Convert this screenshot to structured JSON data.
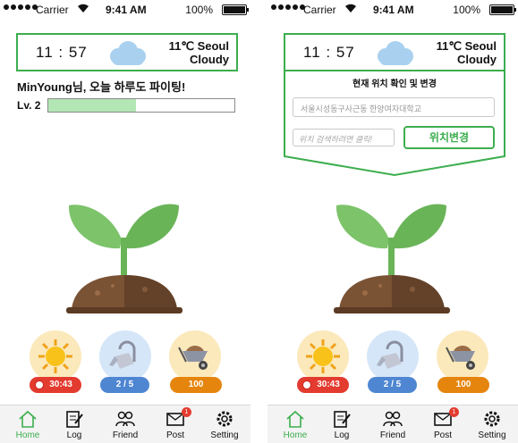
{
  "status": {
    "carrier": "Carrier",
    "time": "9:41 AM",
    "battery": "100%"
  },
  "weather": {
    "clock": "11 : 57",
    "temp_city": "11℃ Seoul",
    "condition": "Cloudy",
    "icon": "cloud-icon"
  },
  "greeting": "MinYoung님, 오늘 하루도 파이팅!",
  "level": {
    "label": "Lv. 2",
    "progress": 0.47
  },
  "actions": [
    {
      "name": "sun",
      "icon": "sun-icon",
      "label": "30:43"
    },
    {
      "name": "water",
      "icon": "watering-can-icon",
      "label": "2 / 5"
    },
    {
      "name": "fertilizer",
      "icon": "wheelbarrow-icon",
      "label": "100"
    }
  ],
  "tabs": [
    {
      "label": "Home",
      "icon": "home-icon"
    },
    {
      "label": "Log",
      "icon": "log-icon"
    },
    {
      "label": "Friend",
      "icon": "friend-icon"
    },
    {
      "label": "Post",
      "icon": "mail-icon",
      "badge": "1"
    },
    {
      "label": "Setting",
      "icon": "gear-icon"
    }
  ],
  "location": {
    "title": "현재 위치 확인 및 변경",
    "address": "서울시성동구사근동 한양여자대학교",
    "search_placeholder": "위치 검색하려면 클릭!",
    "change_button": "위치변경"
  },
  "colors": {
    "accent": "#3cae4e",
    "red": "#e33b2f",
    "blue": "#4e86d2",
    "orange": "#e5850e"
  }
}
